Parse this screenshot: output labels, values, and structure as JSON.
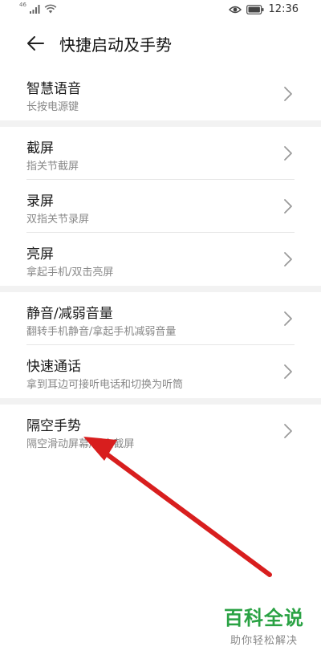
{
  "status_bar": {
    "network_label": "46",
    "time": "12:36"
  },
  "header": {
    "title": "快捷启动及手势"
  },
  "groups": [
    {
      "items": [
        {
          "title": "智慧语音",
          "subtitle": "长按电源键"
        }
      ]
    },
    {
      "items": [
        {
          "title": "截屏",
          "subtitle": "指关节截屏"
        },
        {
          "title": "录屏",
          "subtitle": "双指关节录屏"
        },
        {
          "title": "亮屏",
          "subtitle": "拿起手机/双击亮屏"
        }
      ]
    },
    {
      "items": [
        {
          "title": "静音/减弱音量",
          "subtitle": "翻转手机静音/拿起手机减弱音量"
        },
        {
          "title": "快速通话",
          "subtitle": "拿到耳边可接听电话和切换为听筒"
        }
      ]
    },
    {
      "items": [
        {
          "title": "隔空手势",
          "subtitle": "隔空滑动屏幕/隔空截屏"
        }
      ]
    }
  ],
  "annotation": {
    "color": "#d81e1e"
  },
  "watermark": {
    "title": "百科全说",
    "subtitle": "助你轻松解决"
  }
}
